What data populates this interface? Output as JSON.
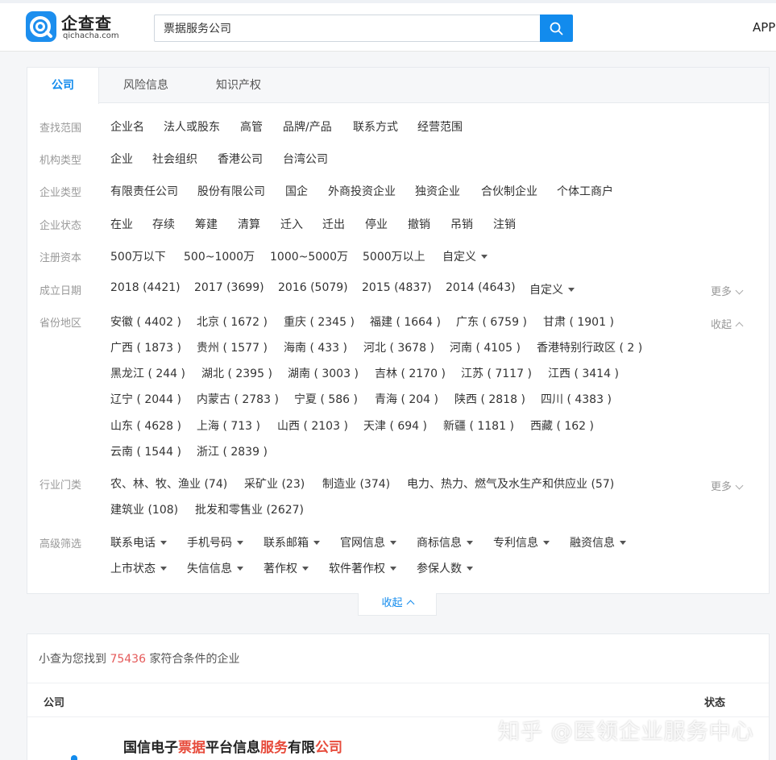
{
  "header": {
    "logo_cn": "企查查",
    "logo_en": "qichacha.com",
    "search_value": "票据服务公司",
    "app_label": "APP"
  },
  "colors": {
    "accent": "#128bed",
    "highlight": "#e74c3c",
    "count": "#e55a5a"
  },
  "tabs": [
    {
      "label": "公司",
      "active": true
    },
    {
      "label": "风险信息",
      "active": false
    },
    {
      "label": "知识产权",
      "active": false
    }
  ],
  "filters": {
    "scope": {
      "label": "查找范围",
      "options": [
        "企业名",
        "法人或股东",
        "高管",
        "品牌/产品",
        "联系方式",
        "经营范围"
      ]
    },
    "org_type": {
      "label": "机构类型",
      "options": [
        "企业",
        "社会组织",
        "香港公司",
        "台湾公司"
      ]
    },
    "ent_type": {
      "label": "企业类型",
      "options": [
        "有限责任公司",
        "股份有限公司",
        "国企",
        "外商投资企业",
        "独资企业",
        "合伙制企业",
        "个体工商户"
      ]
    },
    "status": {
      "label": "企业状态",
      "options": [
        "在业",
        "存续",
        "筹建",
        "清算",
        "迁入",
        "迁出",
        "停业",
        "撤销",
        "吊销",
        "注销"
      ]
    },
    "capital": {
      "label": "注册资本",
      "options": [
        "500万以下",
        "500~1000万",
        "1000~5000万",
        "5000万以上",
        "自定义"
      ]
    },
    "founded": {
      "label": "成立日期",
      "options": [
        "2018 (4421)",
        "2017 (3699)",
        "2016 (5079)",
        "2015 (4837)",
        "2014 (4643)",
        "自定义"
      ],
      "more": "更多"
    },
    "region": {
      "label": "省份地区",
      "collapse": "收起",
      "rows": [
        [
          "安徽 ( 4402 )",
          "北京 ( 1672 )",
          "重庆 ( 2345 )",
          "福建 ( 1664 )",
          "广东 ( 6759 )",
          "甘肃 ( 1901 )"
        ],
        [
          "广西 ( 1873 )",
          "贵州 ( 1577 )",
          "海南 ( 433 )",
          "河北 ( 3678 )",
          "河南 ( 4105 )",
          "香港特别行政区 ( 2 )"
        ],
        [
          "黑龙江 ( 244 )",
          "湖北 ( 2395 )",
          "湖南 ( 3003 )",
          "吉林 ( 2170 )",
          "江苏 ( 7117 )",
          "江西 ( 3414 )"
        ],
        [
          "辽宁 ( 2044 )",
          "内蒙古 ( 2783 )",
          "宁夏 ( 586 )",
          "青海 ( 204 )",
          "陕西 ( 2818 )",
          "四川 ( 4383 )"
        ],
        [
          "山东 ( 4628 )",
          "上海 ( 713 )",
          "山西 ( 2103 )",
          "天津 ( 694 )",
          "新疆 ( 1181 )",
          "西藏 ( 162 )"
        ],
        [
          "云南 ( 1544 )",
          "浙江 ( 2839 )"
        ]
      ]
    },
    "industry": {
      "label": "行业门类",
      "more": "更多",
      "rows": [
        [
          "农、林、牧、渔业 (74)",
          "采矿业 (23)",
          "制造业 (374)",
          "电力、热力、燃气及水生产和供应业 (57)"
        ],
        [
          "建筑业 (108)",
          "批发和零售业 (2627)"
        ]
      ]
    },
    "advanced": {
      "label": "高级筛选",
      "rows": [
        [
          "联系电话",
          "手机号码",
          "联系邮箱",
          "官网信息",
          "商标信息",
          "专利信息",
          "融资信息"
        ],
        [
          "上市状态",
          "失信信息",
          "著作权",
          "软件著作权",
          "参保人数"
        ]
      ]
    }
  },
  "collapse_panel_label": "收起",
  "results": {
    "summary_prefix": "小查为您找到",
    "count": "75436",
    "summary_suffix": "家符合条件的企业",
    "col_company": "公司",
    "col_status": "状态",
    "first_company_parts": [
      "国信电子",
      "票据",
      "平台信息",
      "服务",
      "有限",
      "公司"
    ]
  },
  "watermark": "知乎 @医领企业服务中心"
}
